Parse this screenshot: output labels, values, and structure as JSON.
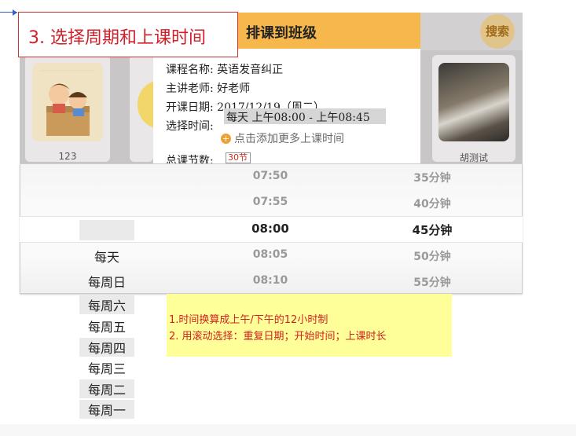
{
  "annotation": {
    "step_title": "3. 选择周期和上课时间"
  },
  "header": {
    "search_label": "搜索"
  },
  "cards": [
    {
      "caption": "123"
    },
    {
      "caption": ""
    },
    {
      "caption": "胡测试"
    }
  ],
  "dialog": {
    "title": "排课到班级",
    "fields": {
      "course_name": "课程名称:  英语发音纠正",
      "teacher": "主讲老师:  好老师",
      "start_date": "开课日期:  2017/12/19（周二）",
      "select_time_label": "选择时间:",
      "selected_time": "每天 上午08:00 - 上午08:45",
      "add_more": "点击添加更多上课时间",
      "total_label": "总课节数:",
      "total_value": "30节"
    }
  },
  "picker": {
    "times": [
      "07:50",
      "07:55",
      "08:00",
      "08:05",
      "08:10"
    ],
    "durations": [
      "35分钟",
      "40分钟",
      "45分钟",
      "50分钟",
      "55分钟"
    ],
    "selected_index": 2,
    "repeat_options": [
      "",
      "每天",
      "每周日",
      "每周六",
      "每周五",
      "每周四",
      "每周三",
      "每周二",
      "每周一"
    ]
  },
  "note": {
    "line1": "1.时间换算成上午/下午的12小时制",
    "line2": "2. 用滚动选择：重复日期；开始时间；上课时长"
  },
  "colors": {
    "accent": "#f6b74c",
    "annotation_red": "#d0202a",
    "note_bg": "#ffff99"
  }
}
